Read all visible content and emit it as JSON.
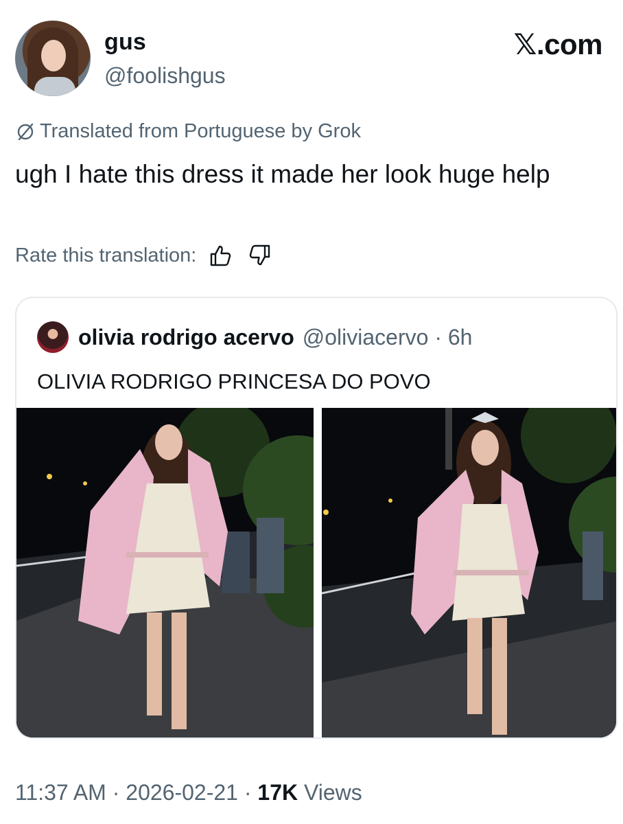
{
  "header": {
    "display_name": "gus",
    "handle": "@foolishgus",
    "brand": "𝕏.com"
  },
  "translation": {
    "label": "Translated from Portuguese by Grok"
  },
  "tweet": {
    "text": "ugh I hate this dress it made her look huge help"
  },
  "rating": {
    "label": "Rate this translation:"
  },
  "quote": {
    "name": "olivia rodrigo acervo",
    "handle_time": "@oliviacervo · 6h",
    "text": "OLIVIA RODRIGO PRINCESA DO POVO"
  },
  "footer": {
    "time_date": "11:37 AM · 2026-02-21 · ",
    "views_count": "17K",
    "views_label": " Views"
  },
  "colors": {
    "text_primary": "#0f1419",
    "text_secondary": "#536471",
    "border": "#e6e9ec",
    "coat_pink": "#e8b6c8"
  }
}
